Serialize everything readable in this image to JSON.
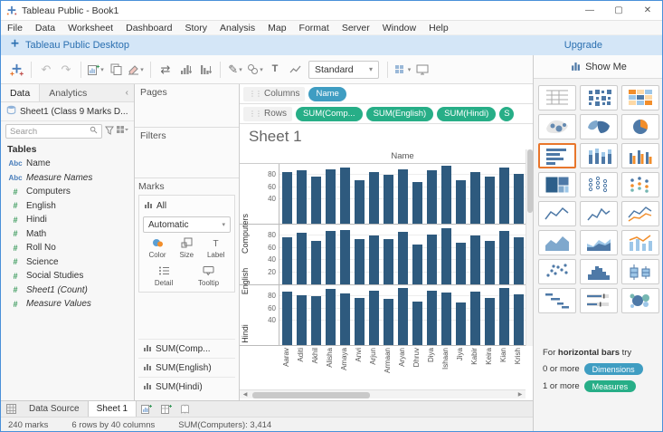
{
  "window": {
    "title": "Tableau Public - Book1",
    "minimize": "—",
    "maximize": "▢",
    "close": "✕"
  },
  "menu": {
    "items": [
      "File",
      "Data",
      "Worksheet",
      "Dashboard",
      "Story",
      "Analysis",
      "Map",
      "Format",
      "Server",
      "Window",
      "Help"
    ]
  },
  "banner": {
    "text": "Tableau Public Desktop",
    "upgrade": "Upgrade"
  },
  "toolbar": {
    "fit_label": "Standard",
    "items": [
      {
        "name": "tableau-logo-icon",
        "icon": "logo",
        "sep_after": true
      },
      {
        "name": "undo-button",
        "icon": "undo",
        "disabled": true
      },
      {
        "name": "redo-button",
        "icon": "redo",
        "disabled": true,
        "sep_after": true
      },
      {
        "name": "new-worksheet-button",
        "icon": "new-sheet",
        "caret": true
      },
      {
        "name": "duplicate-sheet-button",
        "icon": "duplicate"
      },
      {
        "name": "clear-sheet-button",
        "icon": "clear",
        "caret": true,
        "sep_after": true
      },
      {
        "name": "swap-rows-columns-button",
        "icon": "swap"
      },
      {
        "name": "sort-ascending-button",
        "icon": "sort-asc"
      },
      {
        "name": "sort-descending-button",
        "icon": "sort-desc",
        "sep_after": true
      },
      {
        "name": "highlight-button",
        "icon": "highlight",
        "caret": true
      },
      {
        "name": "group-members-button",
        "icon": "group",
        "caret": true
      },
      {
        "name": "text-label-button",
        "icon": "text"
      },
      {
        "name": "fix-axes-button",
        "icon": "spark"
      }
    ],
    "right_items": [
      {
        "name": "mark-labels-button",
        "icon": "marklabels",
        "caret": true
      },
      {
        "name": "presentation-mode-button",
        "icon": "presentation"
      }
    ]
  },
  "sidebar": {
    "tabs": {
      "data": "Data",
      "analytics": "Analytics"
    },
    "datasource": "Sheet1 (Class 9 Marks D...",
    "search_placeholder": "Search",
    "tables_label": "Tables",
    "fields": [
      {
        "label": "Name",
        "type": "dimension",
        "icon": "Abc",
        "italic": false
      },
      {
        "label": "Measure Names",
        "type": "dimension",
        "icon": "Abc",
        "italic": true
      },
      {
        "label": "Computers",
        "type": "measure",
        "icon": "#",
        "italic": false
      },
      {
        "label": "English",
        "type": "measure",
        "icon": "#",
        "italic": false
      },
      {
        "label": "Hindi",
        "type": "measure",
        "icon": "#",
        "italic": false
      },
      {
        "label": "Math",
        "type": "measure",
        "icon": "#",
        "italic": false
      },
      {
        "label": "Roll No",
        "type": "measure",
        "icon": "#",
        "italic": false
      },
      {
        "label": "Science",
        "type": "measure",
        "icon": "#",
        "italic": false
      },
      {
        "label": "Social Studies",
        "type": "measure",
        "icon": "#",
        "italic": false
      },
      {
        "label": "Sheet1 (Count)",
        "type": "measure",
        "icon": "#",
        "italic": true
      },
      {
        "label": "Measure Values",
        "type": "measure",
        "icon": "#",
        "italic": true
      }
    ]
  },
  "cards": {
    "pages": "Pages",
    "filters": "Filters",
    "marks": "Marks",
    "all_label": "All",
    "mark_type": "Automatic",
    "mark_buttons": [
      {
        "label": "Color",
        "icon": "color"
      },
      {
        "label": "Size",
        "icon": "size"
      },
      {
        "label": "Label",
        "icon": "label"
      }
    ],
    "mark_buttons2": [
      {
        "label": "Detail",
        "icon": "detail"
      },
      {
        "label": "Tooltip",
        "icon": "tooltip"
      }
    ],
    "measure_cards": [
      "SUM(Comp...",
      "SUM(English)",
      "SUM(Hindi)"
    ]
  },
  "shelves": {
    "columns_label": "Columns",
    "rows_label": "Rows",
    "columns_pills": [
      "Name"
    ],
    "rows_pills": [
      "SUM(Comp...",
      "SUM(English)",
      "SUM(Hindi)",
      "S"
    ]
  },
  "sheet": {
    "title": "Sheet 1"
  },
  "chart_data": {
    "type": "bar",
    "title": "Sheet 1",
    "column_header": "Name",
    "orientation": "vertical",
    "bar_color": "#2e5a7e",
    "ylim": [
      0,
      100
    ],
    "grid": true,
    "categories": [
      "Aarav",
      "Aditi",
      "Akhil",
      "Alisha",
      "Amaya",
      "Anvi",
      "Arjun",
      "Armaan",
      "Aryan",
      "Dhruv",
      "Diya",
      "Ishaan",
      "Jiya",
      "Kabir",
      "Keira",
      "Kian",
      "Krish"
    ],
    "series": [
      {
        "name": "Computers",
        "ticks": [
          40,
          60,
          80
        ],
        "values": [
          85,
          88,
          78,
          90,
          92,
          72,
          85,
          80,
          90,
          68,
          88,
          95,
          72,
          85,
          78,
          92,
          82
        ]
      },
      {
        "name": "English",
        "ticks": [
          20,
          40,
          60,
          80
        ],
        "values": [
          78,
          85,
          72,
          88,
          90,
          75,
          80,
          74,
          86,
          65,
          82,
          92,
          68,
          80,
          72,
          88,
          78
        ]
      },
      {
        "name": "Hindi",
        "ticks": [
          40,
          60,
          80
        ],
        "values": [
          88,
          82,
          80,
          92,
          85,
          78,
          90,
          76,
          94,
          72,
          90,
          86,
          70,
          88,
          78,
          94,
          84
        ]
      }
    ]
  },
  "showme": {
    "header": "Show Me",
    "selected_index": 6,
    "items": [
      "text-table",
      "heat-map",
      "highlight-table",
      "symbol-map",
      "filled-map",
      "pie-chart",
      "horizontal-bars",
      "stacked-bars",
      "side-by-side-bars",
      "treemap",
      "circle-views",
      "side-by-side-circles",
      "continuous-lines",
      "discrete-lines",
      "dual-lines",
      "area-chart-continuous",
      "area-chart-discrete",
      "dual-combination",
      "scatter-plot",
      "histogram",
      "box-and-whisker",
      "gantt",
      "bullet-graph",
      "packed-bubbles"
    ],
    "hint_for": "For",
    "hint_bold": "horizontal bars",
    "hint_try": "try",
    "req1_text": "0 or more",
    "req1_pill": "Dimensions",
    "req2_text": "1 or more",
    "req2_pill": "Measures"
  },
  "bottom_tabs": {
    "data_source": "Data Source",
    "sheet1": "Sheet 1"
  },
  "status": {
    "marks": "240 marks",
    "size": "6 rows by 40 columns",
    "aggregate": "SUM(Computers): 3,414"
  },
  "colors": {
    "accent_orange": "#e8762c",
    "pill_dimension": "#3f9dc2",
    "pill_measure": "#27ae87",
    "bar": "#2e5a7e",
    "banner_bg": "#d4e6f7"
  }
}
